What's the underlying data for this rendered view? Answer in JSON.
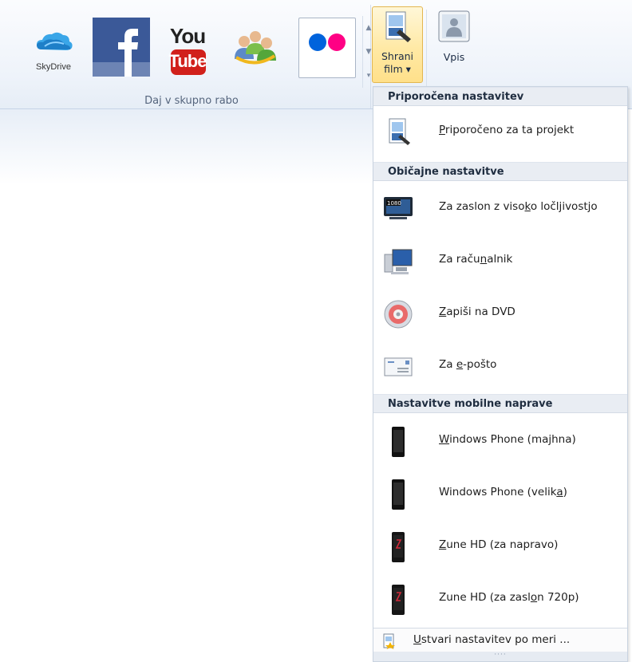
{
  "ribbon": {
    "share_group_label": "Daj v skupno rabo",
    "gallery": [
      {
        "name": "SkyDrive",
        "label": "SkyDrive",
        "icon": "skydrive-icon"
      },
      {
        "name": "Facebook",
        "icon": "facebook-icon"
      },
      {
        "name": "YouTube",
        "logo_top": "You",
        "logo_bottom": "Tube",
        "icon": "youtube-icon"
      },
      {
        "name": "Group",
        "icon": "people-icon"
      },
      {
        "name": "Flickr",
        "icon": "flickr-icon"
      }
    ],
    "save_button": {
      "line1": "Shrani",
      "line2": "film ▾",
      "icon": "save-movie-icon"
    },
    "signin_button": {
      "label": "Vpis",
      "icon": "user-icon"
    }
  },
  "dropdown": {
    "sections": [
      {
        "title": "Priporočena nastavitev",
        "items": [
          {
            "pre": "",
            "u": "P",
            "post": "riporočeno za ta projekt",
            "icon": "recommended-movie-icon"
          }
        ]
      },
      {
        "title": "Običajne nastavitve",
        "items": [
          {
            "pre": "Za zaslon z viso",
            "u": "k",
            "post": "o ločljivostjo",
            "icon": "hd-display-icon",
            "badge": "1080"
          },
          {
            "pre": "Za raču",
            "u": "n",
            "post": "alnik",
            "icon": "computer-icon"
          },
          {
            "pre": "",
            "u": "Z",
            "post": "apiši na DVD",
            "icon": "dvd-icon"
          },
          {
            "pre": "Za ",
            "u": "e",
            "post": "-pošto",
            "icon": "email-icon"
          }
        ]
      },
      {
        "title": "Nastavitve mobilne naprave",
        "items": [
          {
            "pre": "",
            "u": "W",
            "post": "indows Phone (majhna)",
            "icon": "windows-phone-icon"
          },
          {
            "pre": "Windows Phone (velik",
            "u": "a",
            "post": ")",
            "icon": "windows-phone-icon"
          },
          {
            "pre": "",
            "u": "Z",
            "post": "une HD (za napravo)",
            "icon": "zune-hd-icon"
          },
          {
            "pre": "Zune HD (za zasl",
            "u": "o",
            "post": "n 720p)",
            "icon": "zune-hd-icon"
          }
        ]
      }
    ],
    "footer": {
      "pre": "",
      "u": "U",
      "post": "stvari nastavitev po meri ...",
      "icon": "custom-settings-icon"
    },
    "grip": "····"
  }
}
